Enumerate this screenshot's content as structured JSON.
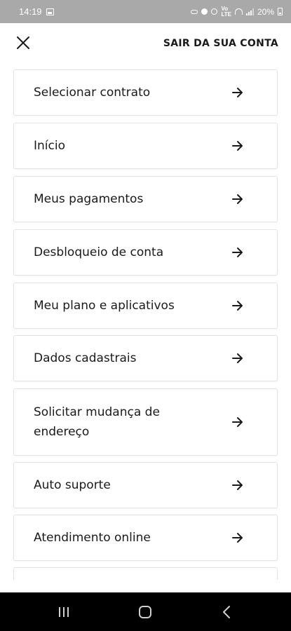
{
  "status_bar": {
    "time": "14:19",
    "battery": "20%",
    "icons": [
      "gallery-icon",
      "key-icon",
      "account-icon",
      "alarm-icon",
      "volte-icon",
      "wifi-icon",
      "signal-icon",
      "battery-icon"
    ]
  },
  "header": {
    "close_icon": "close-icon",
    "logout_label": "SAIR DA SUA CONTA"
  },
  "menu": {
    "items": [
      {
        "label": "Selecionar contrato"
      },
      {
        "label": "Início"
      },
      {
        "label": "Meus pagamentos"
      },
      {
        "label": "Desbloqueio de conta"
      },
      {
        "label": "Meu plano e aplicativos"
      },
      {
        "label": "Dados cadastrais"
      },
      {
        "label": "Solicitar mudança de endereço"
      },
      {
        "label": "Auto suporte"
      },
      {
        "label": "Atendimento online"
      }
    ],
    "arrow_icon": "arrow-right-icon"
  },
  "nav_bar": {
    "buttons": [
      "recent-apps-icon",
      "home-icon",
      "back-icon"
    ]
  },
  "colors": {
    "status_bar_bg": "#a9a9a9",
    "text": "#1a1a1a",
    "card_border": "#e3e3e3",
    "nav_bar_bg": "#000000"
  }
}
